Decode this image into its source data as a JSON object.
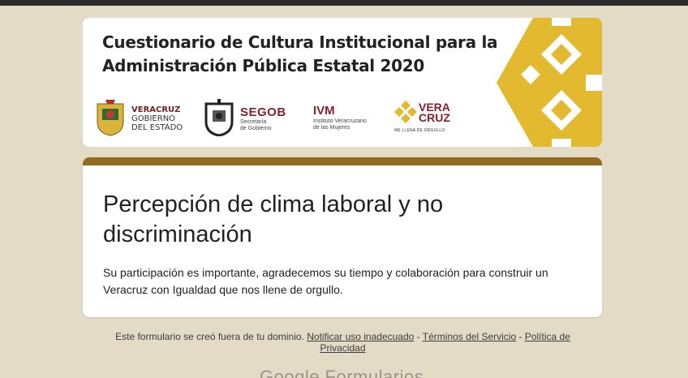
{
  "banner": {
    "title_line1": "Cuestionario de Cultura Institucional para la",
    "title_line2": "Administración Pública Estatal 2020",
    "logos": {
      "veracruz": {
        "line1": "VERACRUZ",
        "line2": "GOBIERNO",
        "line3": "DEL ESTADO"
      },
      "segob": {
        "name": "SEGOB",
        "subtitle_line1": "Secretaría",
        "subtitle_line2": "de Gobierno"
      },
      "ivm": {
        "name": "IVM",
        "subtitle_line1": "Instituto Veracruzano",
        "subtitle_line2": "de las Mujeres"
      },
      "veracruz_brand": {
        "line1": "VERA",
        "line2": "CRUZ",
        "tagline": "ME LLENA DE ORGULLO"
      }
    },
    "accent_color": "#e2b92f"
  },
  "form": {
    "title": "Percepción de clima laboral y no discriminación",
    "description": "Su participación es importante, agradecemos su tiempo y colaboración para construir un Veracruz con Igualdad que nos llene de orgullo.",
    "header_color": "#8f6c1f"
  },
  "footer": {
    "prefix": "Este formulario se creó fuera de tu dominio.",
    "report_link": "Notificar uso inadecuado",
    "sep1": " - ",
    "terms_link": "Términos del Servicio",
    "sep2": " - ",
    "privacy_link": "Política de Privacidad"
  },
  "brand": {
    "label": "Google Formularios"
  },
  "colors": {
    "background": "#e4dbc7",
    "card": "#ffffff"
  }
}
